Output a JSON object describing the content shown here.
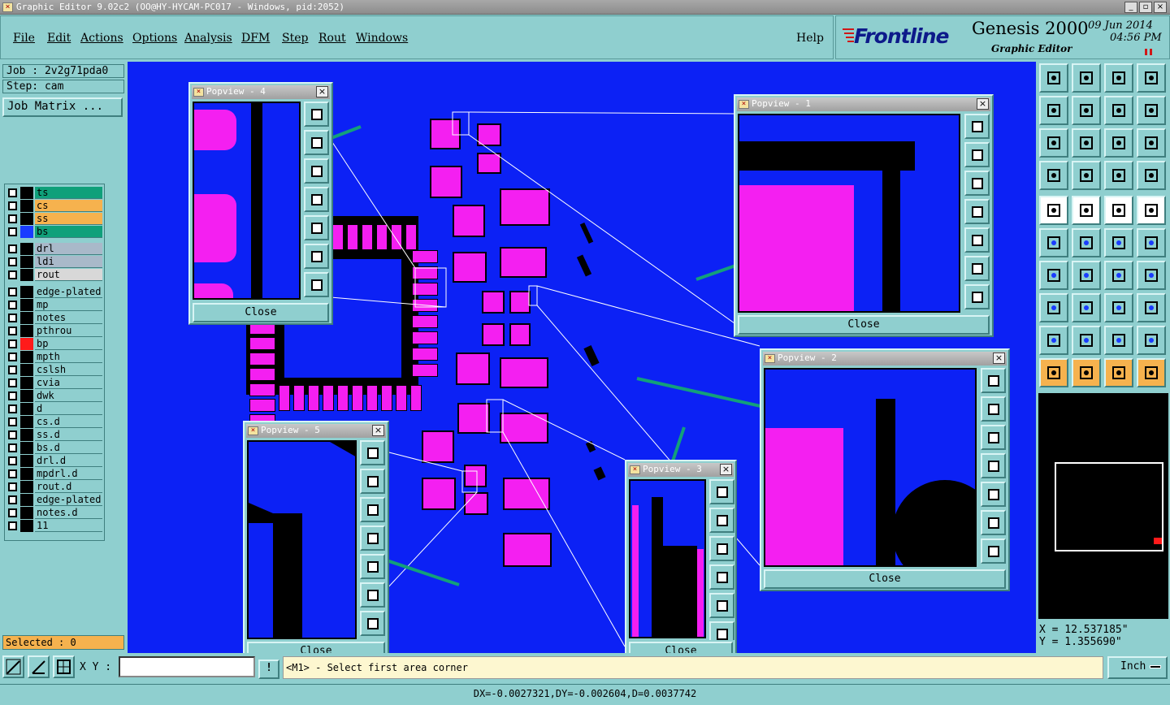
{
  "app": {
    "title": "Graphic Editor 9.02c2 (OO@HY-HYCAM-PC017 - Windows, pid:2052)"
  },
  "menu": {
    "items": [
      "File",
      "Edit",
      "Actions",
      "Options",
      "Analysis",
      "DFM",
      "Step",
      "Rout",
      "Windows"
    ],
    "help": "Help"
  },
  "brand": {
    "logo": "Frontline",
    "product": "Genesis 2000",
    "subtitle": "Graphic Editor",
    "date": "09 Jun 2014",
    "time": "04:56 PM"
  },
  "job": {
    "job_label": "Job : 2v2g71pda0",
    "step_label": "Step: cam",
    "matrix_button": "Job Matrix ..."
  },
  "layers": [
    {
      "name": "ts",
      "color": "#0fa07a",
      "swatch": "#000"
    },
    {
      "name": "cs",
      "color": "#f6b24e",
      "swatch": "#000"
    },
    {
      "name": "ss",
      "color": "#f6b24e",
      "swatch": "#000"
    },
    {
      "name": "bs",
      "color": "#0fa07a",
      "swatch": "#1a3cff"
    },
    {
      "name": "drl",
      "color": "#a9b9c9",
      "swatch": "#000"
    },
    {
      "name": "ldi",
      "color": "#a9b9c9",
      "swatch": "#000"
    },
    {
      "name": "rout",
      "color": "#d8d8d8",
      "swatch": "#000"
    },
    {
      "name": "edge-plated",
      "color": "#8fcfcf",
      "swatch": "#000"
    },
    {
      "name": "mp",
      "color": "#8fcfcf",
      "swatch": "#000"
    },
    {
      "name": "notes",
      "color": "#8fcfcf",
      "swatch": "#000"
    },
    {
      "name": "pthrou",
      "color": "#8fcfcf",
      "swatch": "#000"
    },
    {
      "name": "bp",
      "color": "#8fcfcf",
      "swatch": "#ff1a1a"
    },
    {
      "name": "mpth",
      "color": "#8fcfcf",
      "swatch": "#000"
    },
    {
      "name": "cslsh",
      "color": "#8fcfcf",
      "swatch": "#000"
    },
    {
      "name": "cvia",
      "color": "#8fcfcf",
      "swatch": "#000"
    },
    {
      "name": "dwk",
      "color": "#8fcfcf",
      "swatch": "#000"
    },
    {
      "name": "d",
      "color": "#8fcfcf",
      "swatch": "#000"
    },
    {
      "name": "cs.d",
      "color": "#8fcfcf",
      "swatch": "#000"
    },
    {
      "name": "ss.d",
      "color": "#8fcfcf",
      "swatch": "#000"
    },
    {
      "name": "bs.d",
      "color": "#8fcfcf",
      "swatch": "#000"
    },
    {
      "name": "drl.d",
      "color": "#8fcfcf",
      "swatch": "#000"
    },
    {
      "name": "mpdrl.d",
      "color": "#8fcfcf",
      "swatch": "#000"
    },
    {
      "name": "rout.d",
      "color": "#8fcfcf",
      "swatch": "#000"
    },
    {
      "name": "edge-plated",
      "color": "#8fcfcf",
      "swatch": "#000"
    },
    {
      "name": "notes.d",
      "color": "#8fcfcf",
      "swatch": "#000"
    },
    {
      "name": "11",
      "color": "#8fcfcf",
      "swatch": "#000"
    }
  ],
  "selected": "Selected : 0",
  "popviews": [
    {
      "title": "Popview - 4",
      "close": "Close"
    },
    {
      "title": "Popview - 1",
      "close": "Close"
    },
    {
      "title": "Popview - 2",
      "close": "Close"
    },
    {
      "title": "Popview - 5",
      "close": "Close"
    },
    {
      "title": "Popview - 3",
      "close": "Close"
    }
  ],
  "coords": {
    "x": "X = 12.537185\"",
    "y": "Y = 1.355690\""
  },
  "xy_label": "X Y :",
  "xy_value": "",
  "prompt": "<M1> - Select first area corner",
  "units": "Inch",
  "status": "DX=-0.0027321,DY=-0.002604,D=0.0037742",
  "colors": {
    "canvas": "#0c21f5",
    "pad": "#f41ff1",
    "panel": "#8fcfcf",
    "arrow": "#13a07a"
  }
}
